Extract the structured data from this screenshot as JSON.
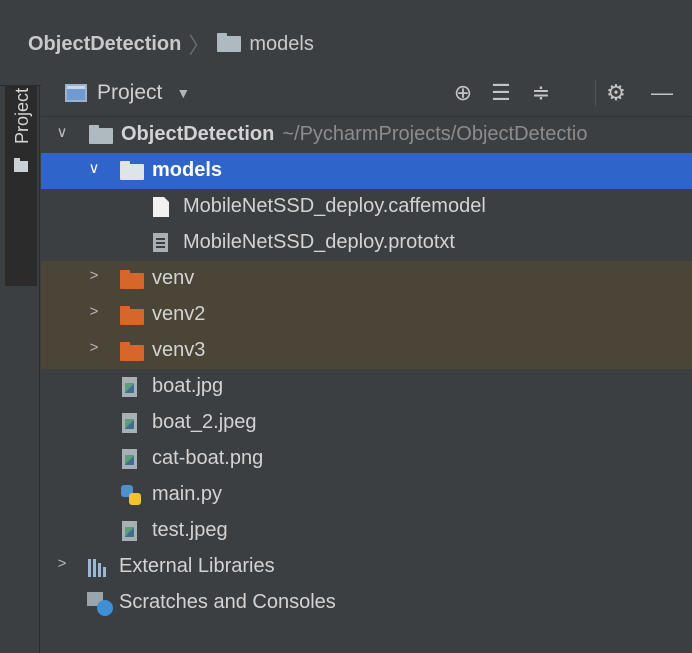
{
  "breadcrumb": {
    "root": "ObjectDetection",
    "current": "models"
  },
  "side_tab": {
    "label": "Project"
  },
  "toolbar": {
    "view_label": "Project",
    "icons": [
      "locate-icon",
      "expand-all-icon",
      "collapse-all-icon",
      "gear-icon",
      "hide-icon"
    ]
  },
  "tree": {
    "root": {
      "name": "ObjectDetection",
      "path": "~/PycharmProjects/ObjectDetectio"
    },
    "models": {
      "name": "models",
      "files": [
        "MobileNetSSD_deploy.caffemodel",
        "MobileNetSSD_deploy.prototxt"
      ]
    },
    "excluded_dirs": [
      "venv",
      "venv2",
      "venv3"
    ],
    "files": [
      "boat.jpg",
      "boat_2.jpeg",
      "cat-boat.png",
      "main.py",
      "test.jpeg"
    ],
    "external_libraries": "External Libraries",
    "scratches": "Scratches and Consoles"
  },
  "colors": {
    "background": "#3c3f41",
    "selection": "#2f65ca",
    "excluded_row": "#4b4538",
    "excluded_folder": "#d6662a"
  }
}
